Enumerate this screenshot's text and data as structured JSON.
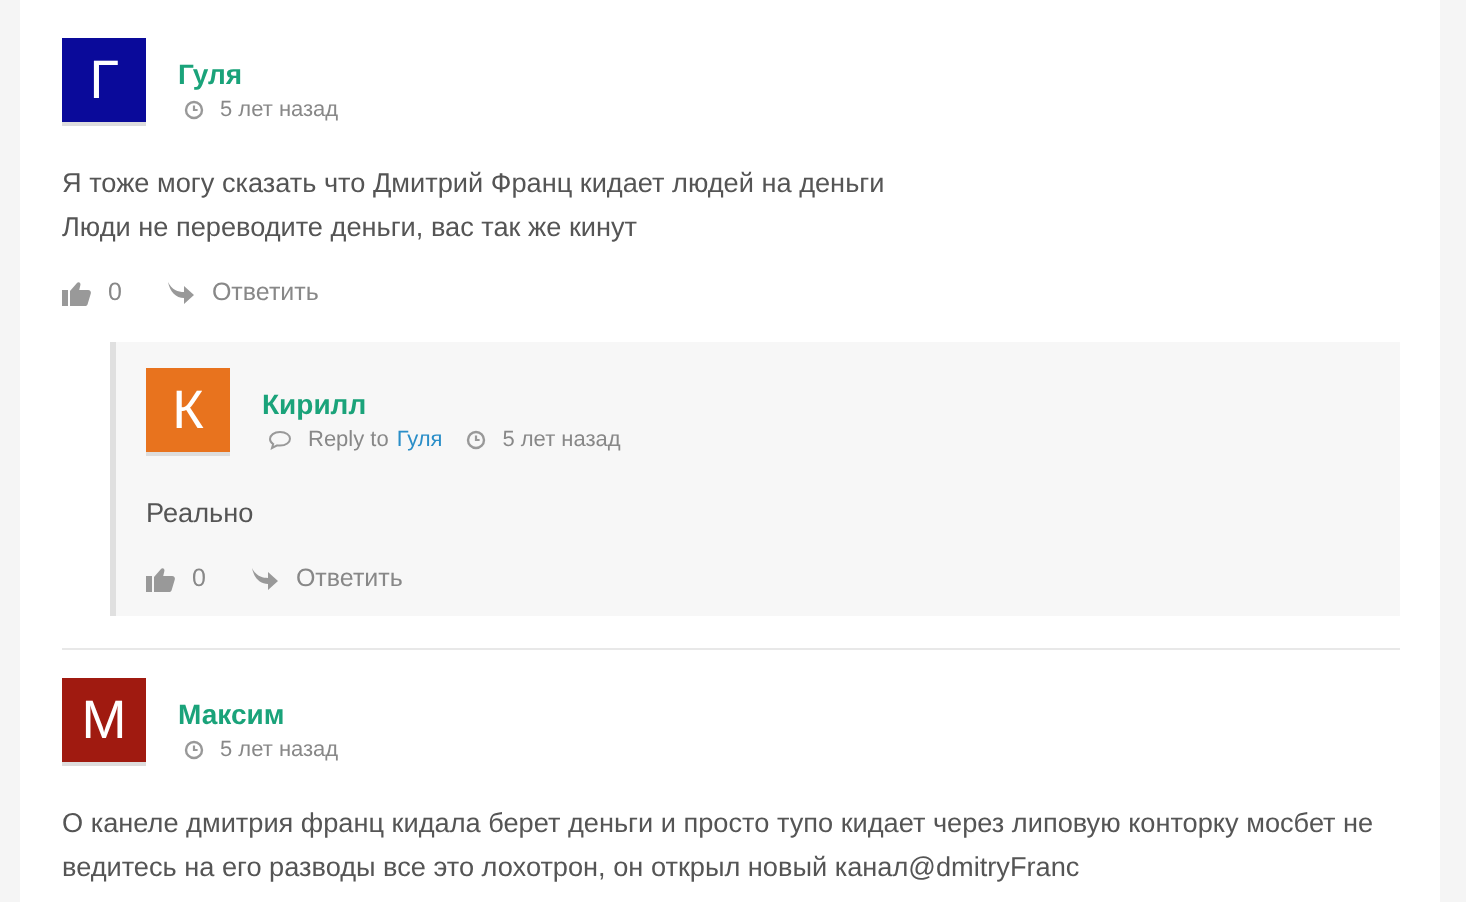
{
  "comments": [
    {
      "avatar_letter": "Г",
      "color": "#0a0a9a",
      "author": "Гуля",
      "time": "5 лет назад",
      "lines": [
        "Я тоже могу сказать что Дмитрий Франц кидает людей на деньги",
        "Люди не переводите деньги, вас так же кинут"
      ],
      "likes": "0",
      "reply_label": "Ответить",
      "replies": [
        {
          "avatar_letter": "К",
          "color": "#e8731e",
          "author": "Кирилл",
          "reply_to_label": "Reply to",
          "reply_to": "Гуля",
          "time": "5 лет назад",
          "lines": [
            "Реально"
          ],
          "likes": "0",
          "reply_label": "Ответить"
        }
      ]
    },
    {
      "avatar_letter": "М",
      "color": "#a01a10",
      "author": "Максим",
      "time": "5 лет назад",
      "lines": [
        "О канеле дмитрия франц кидала берет деньги и просто тупо кидает через липовую конторку мосбет не ведитесь на его разводы все это лохотрон, он открыл новый канал@dmitryFranc"
      ]
    }
  ]
}
